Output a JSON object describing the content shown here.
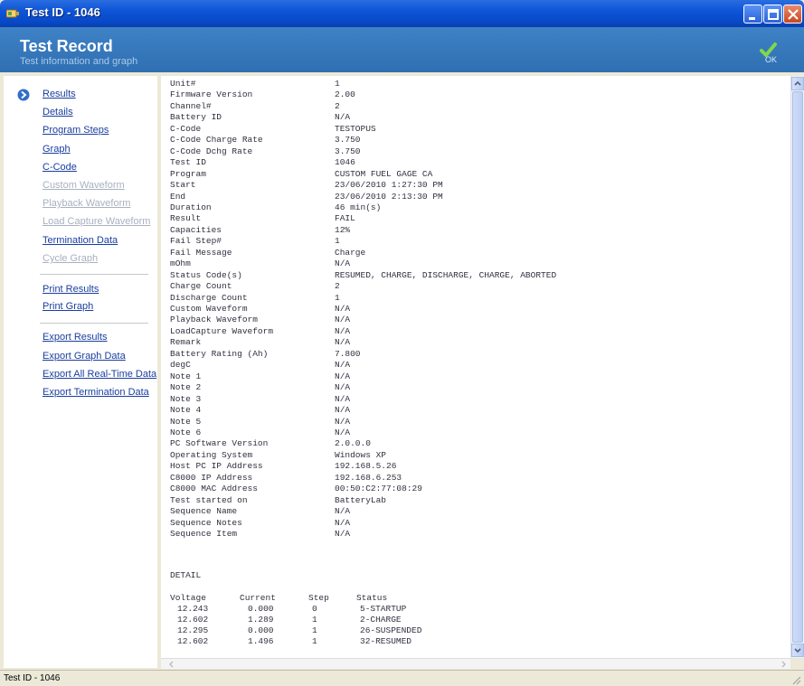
{
  "window": {
    "title": "Test ID - 1046"
  },
  "header": {
    "title": "Test Record",
    "subtitle": "Test information and graph",
    "ok_label": "OK"
  },
  "sidebar": {
    "items": [
      {
        "label": "Results",
        "enabled": true,
        "active": true
      },
      {
        "label": "Details",
        "enabled": true
      },
      {
        "label": "Program Steps",
        "enabled": true
      },
      {
        "label": "Graph",
        "enabled": true
      },
      {
        "label": "C-Code",
        "enabled": true
      },
      {
        "label": "Custom Waveform",
        "enabled": false
      },
      {
        "label": "Playback Waveform",
        "enabled": false
      },
      {
        "label": "Load Capture Waveform",
        "enabled": false
      },
      {
        "label": "Termination Data",
        "enabled": true
      },
      {
        "label": "Cycle Graph",
        "enabled": false
      },
      {
        "label": "Print Results",
        "enabled": true
      },
      {
        "label": "Print Graph",
        "enabled": true
      },
      {
        "label": "Export Results",
        "enabled": true
      },
      {
        "label": "Export Graph Data",
        "enabled": true
      },
      {
        "label": "Export All Real-Time Data",
        "enabled": true
      },
      {
        "label": "Export Termination Data",
        "enabled": true
      }
    ]
  },
  "record": [
    {
      "label": "Unit#",
      "value": "1"
    },
    {
      "label": "Firmware Version",
      "value": "2.00"
    },
    {
      "label": "Channel#",
      "value": "2"
    },
    {
      "label": "Battery ID",
      "value": "N/A"
    },
    {
      "label": "C-Code",
      "value": "TESTOPUS"
    },
    {
      "label": "C-Code Charge Rate",
      "value": "3.750"
    },
    {
      "label": "C-Code Dchg Rate",
      "value": "3.750"
    },
    {
      "label": "Test ID",
      "value": "1046"
    },
    {
      "label": "Program",
      "value": "CUSTOM FUEL GAGE CA"
    },
    {
      "label": "Start",
      "value": "23/06/2010 1:27:30 PM"
    },
    {
      "label": "End",
      "value": "23/06/2010 2:13:30 PM"
    },
    {
      "label": "Duration",
      "value": "46 min(s)"
    },
    {
      "label": "Result",
      "value": "FAIL"
    },
    {
      "label": "Capacities",
      "value": "12%"
    },
    {
      "label": "Fail Step#",
      "value": "1"
    },
    {
      "label": "Fail Message",
      "value": "Charge"
    },
    {
      "label": "mOhm",
      "value": "N/A"
    },
    {
      "label": "Status Code(s)",
      "value": "RESUMED, CHARGE, DISCHARGE, CHARGE, ABORTED"
    },
    {
      "label": "Charge Count",
      "value": "2"
    },
    {
      "label": "Discharge Count",
      "value": "1"
    },
    {
      "label": "Custom Waveform",
      "value": "N/A"
    },
    {
      "label": "Playback Waveform",
      "value": "N/A"
    },
    {
      "label": "LoadCapture Waveform",
      "value": "N/A"
    },
    {
      "label": "Remark",
      "value": "N/A"
    },
    {
      "label": "Battery Rating (Ah)",
      "value": "7.800"
    },
    {
      "label": "degC",
      "value": "N/A"
    },
    {
      "label": "Note 1",
      "value": "N/A"
    },
    {
      "label": "Note 2",
      "value": "N/A"
    },
    {
      "label": "Note 3",
      "value": "N/A"
    },
    {
      "label": "Note 4",
      "value": "N/A"
    },
    {
      "label": "Note 5",
      "value": "N/A"
    },
    {
      "label": "Note 6",
      "value": "N/A"
    },
    {
      "label": "PC Software Version",
      "value": "2.0.0.0"
    },
    {
      "label": "Operating System",
      "value": "Windows XP"
    },
    {
      "label": "Host PC IP Address",
      "value": "192.168.5.26"
    },
    {
      "label": "C8000 IP Address",
      "value": "192.168.6.253"
    },
    {
      "label": "C8000 MAC Address",
      "value": "00:50:C2:77:08:29"
    },
    {
      "label": "Test started on",
      "value": "BatteryLab"
    },
    {
      "label": "Sequence Name",
      "value": "N/A"
    },
    {
      "label": "Sequence Notes",
      "value": "N/A"
    },
    {
      "label": "Sequence Item",
      "value": "N/A"
    }
  ],
  "detail": {
    "heading": "DETAIL",
    "columns": [
      "Voltage",
      "Current",
      "Step",
      "Status"
    ],
    "rows": [
      [
        "12.243",
        "0.000",
        "0",
        "5-STARTUP"
      ],
      [
        "12.602",
        "1.289",
        "1",
        "2-CHARGE"
      ],
      [
        "12.295",
        "0.000",
        "1",
        "26-SUSPENDED"
      ],
      [
        "12.602",
        "1.496",
        "1",
        "32-RESUMED"
      ]
    ]
  },
  "status_bar": {
    "text": "Test ID - 1046"
  }
}
